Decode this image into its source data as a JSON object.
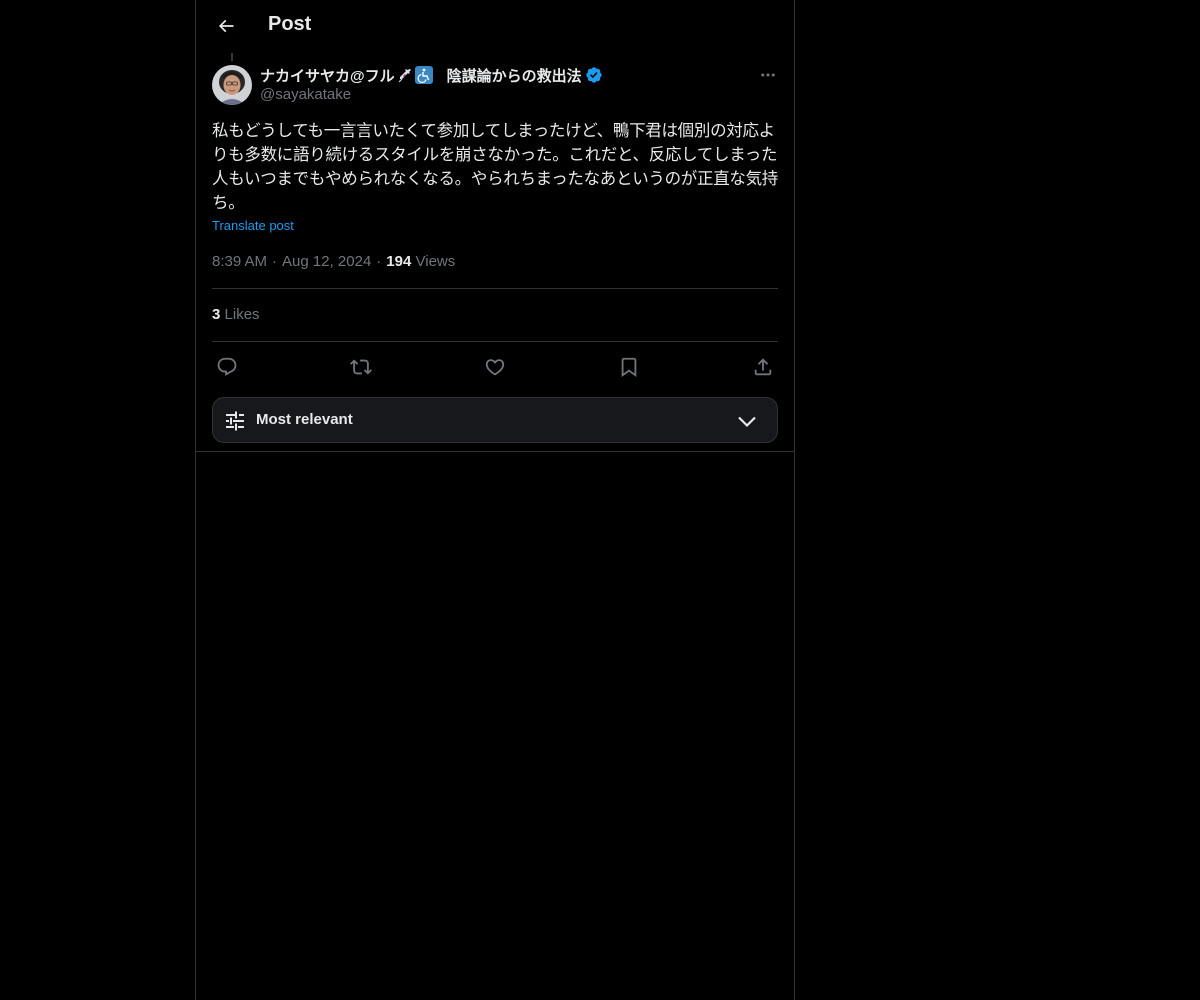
{
  "header": {
    "title": "Post",
    "back_icon": "arrow-left-icon"
  },
  "post": {
    "author": {
      "display_name": "ナカイサヤカ@フル",
      "name_emojis": [
        "syringe-icon",
        "wheelchair-icon"
      ],
      "name_suffix": "陰謀論からの救出法",
      "handle": "@sayakatake",
      "verified": true
    },
    "text": "私もどうしても一言言いたくて参加してしまったけど、鴨下君は個別の対応よりも多数に語り続けるスタイルを崩さなかった。これだと、反応してしまった人もいつまでもやめられなくなる。やられちまったなあというのが正直な気持ち。",
    "translate_label": "Translate post",
    "time": "8:39 AM",
    "date": "Aug 12, 2024",
    "views_count": "194",
    "views_label": "Views",
    "likes_count": "3",
    "likes_label": "Likes"
  },
  "sort": {
    "label": "Most relevant"
  },
  "colors": {
    "background": "#000000",
    "text": "#e7e9ea",
    "muted": "#71767b",
    "accent": "#1d9bf0",
    "border": "#2f3336"
  }
}
